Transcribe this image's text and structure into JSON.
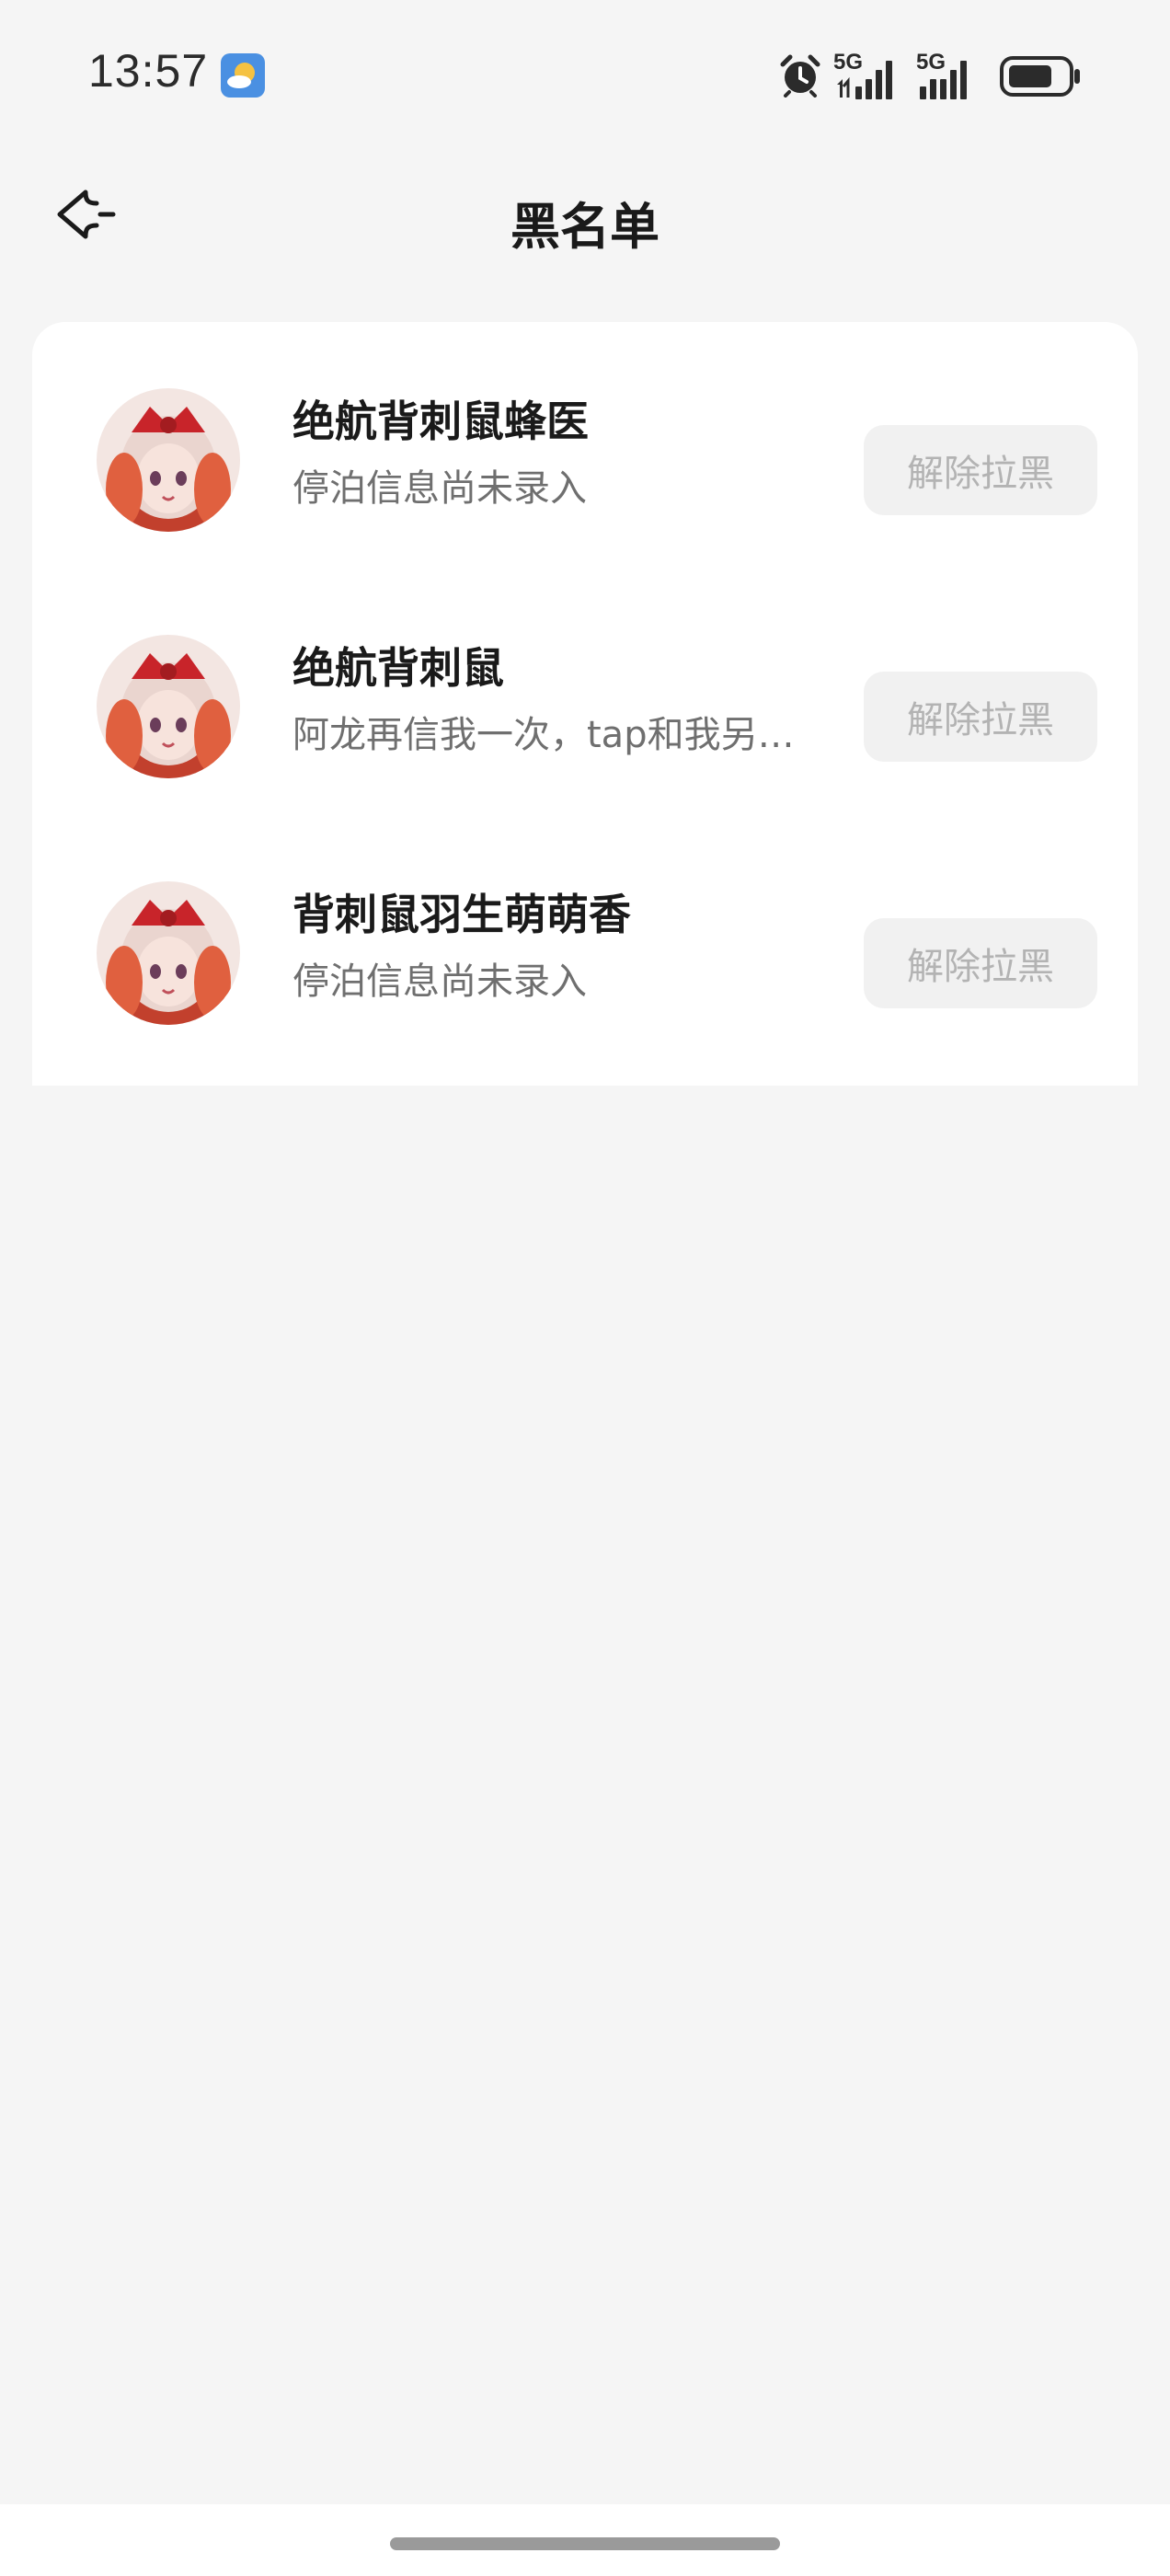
{
  "status_bar": {
    "time": "13:57",
    "network_1": "5G",
    "network_2": "5G",
    "icons": [
      "weather-icon",
      "alarm-icon",
      "signal-icon",
      "signal-icon",
      "battery-icon"
    ]
  },
  "header": {
    "title": "黑名单",
    "back_icon": "back-arrow-icon"
  },
  "blocklist": {
    "items": [
      {
        "name": "绝航背刺鼠蜂医",
        "subtitle": "停泊信息尚未录入",
        "action": "解除拉黑"
      },
      {
        "name": "绝航背刺鼠",
        "subtitle": "阿龙再信我一次，tap和我另…",
        "action": "解除拉黑"
      },
      {
        "name": "背刺鼠羽生萌萌香",
        "subtitle": "停泊信息尚未录入",
        "action": "解除拉黑"
      }
    ]
  },
  "colors": {
    "background": "#f5f5f5",
    "card": "#ffffff",
    "button_bg": "#f1f1f1",
    "button_text": "#b3b3b3"
  }
}
